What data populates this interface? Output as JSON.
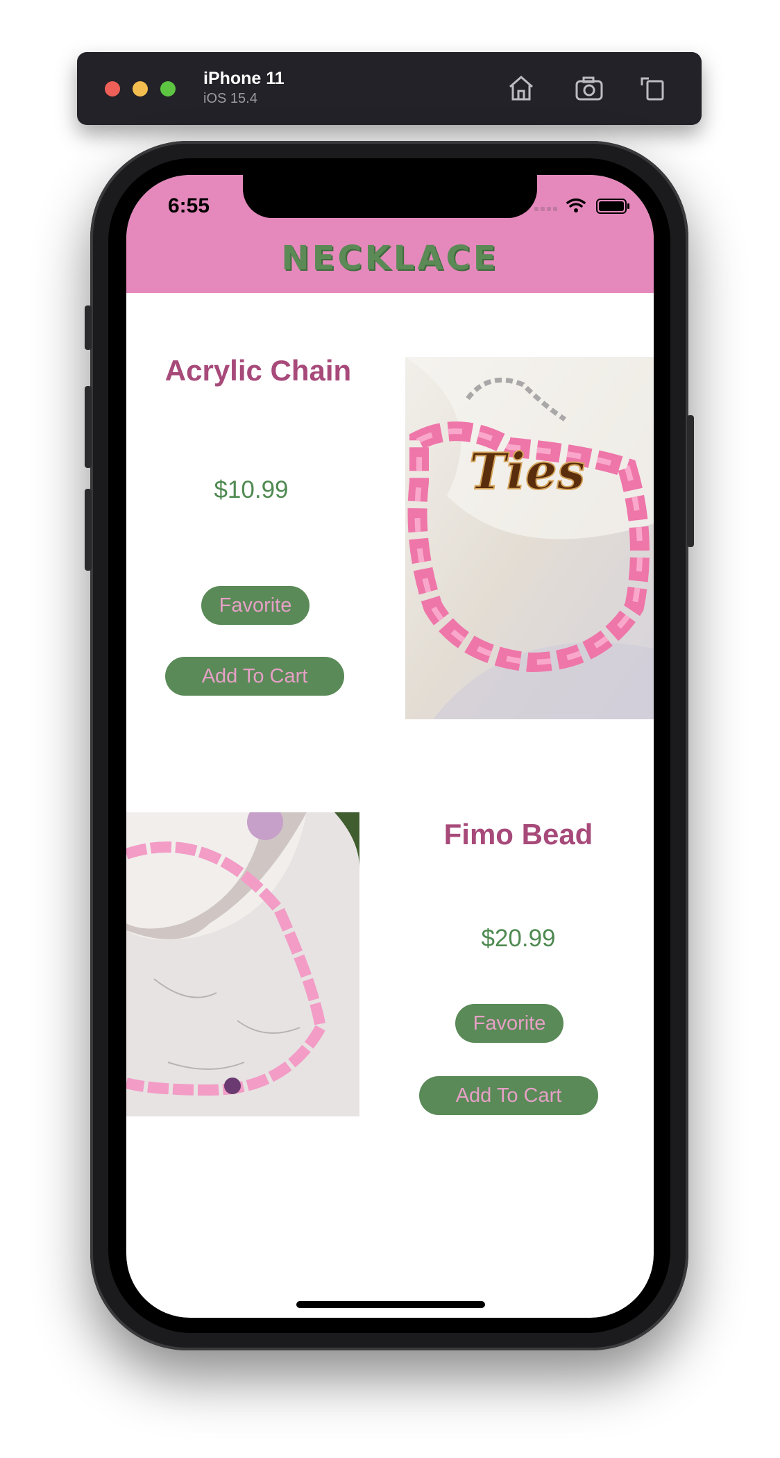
{
  "simulator": {
    "device_name": "iPhone 11",
    "os_version": "iOS 15.4",
    "icons": [
      "home-icon",
      "screenshot-camera-icon",
      "rotate-icon"
    ]
  },
  "status_bar": {
    "time": "6:55"
  },
  "app": {
    "header_title": "NECKLACE",
    "colors": {
      "header": "#e589bc",
      "title": "#a74a7a",
      "price": "#4f8a51",
      "button_bg": "#5a8a57",
      "button_text": "#e5a0c6"
    }
  },
  "products": [
    {
      "name": "Acrylic Chain",
      "price": "$10.99",
      "favorite_label": "Favorite",
      "cart_label": "Add To Cart"
    },
    {
      "name": "Fimo Bead",
      "price": "$20.99",
      "favorite_label": "Favorite",
      "cart_label": "Add To Cart"
    }
  ],
  "image_lettering": {
    "acrylic_chain_pendant": "Ties"
  }
}
